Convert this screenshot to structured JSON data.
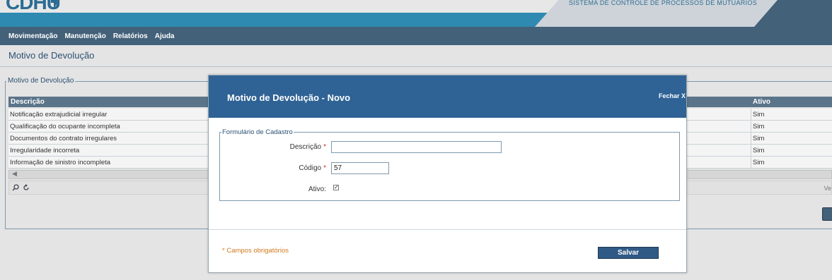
{
  "app": {
    "logo_text": "CDHU",
    "system_title": "SISTEMA DE CONTROLE DE PROCESSOS DE MUTUÁRIOS"
  },
  "menu": [
    "Movimentação",
    "Manutenção",
    "Relatórios",
    "Ajuda"
  ],
  "page": {
    "title": "Motivo de Devolução"
  },
  "grid": {
    "legend": "Motivo de Devolução",
    "columns": {
      "descricao": "Descrição",
      "ativo": "Ativo"
    },
    "rows": [
      {
        "descricao": "Notificação extrajudicial irregular",
        "ativo": "Sim"
      },
      {
        "descricao": "Qualificação do ocupante incompleta",
        "ativo": "Sim"
      },
      {
        "descricao": "Documentos do contrato irregulares",
        "ativo": "Sim"
      },
      {
        "descricao": "Irregularidade incorreta",
        "ativo": "Sim"
      },
      {
        "descricao": "Informação de sinistro incompleta",
        "ativo": "Sim"
      }
    ],
    "pager_right_text": "Ve",
    "icons": {
      "search": "search-icon",
      "refresh": "refresh-icon"
    }
  },
  "modal": {
    "title": "Motivo de Devolução - Novo",
    "close_label": "Fechar X",
    "form_legend": "Formulário de Cadastro",
    "fields": {
      "descricao": {
        "label": "Descrição",
        "required_mark": "*",
        "value": ""
      },
      "codigo": {
        "label": "Código",
        "required_mark": "*",
        "value": "57"
      },
      "ativo": {
        "label": "Ativo:",
        "checked": true
      }
    },
    "required_note": "* Campos obrigatórios",
    "save_label": "Salvar"
  },
  "colors": {
    "menubar": "#436179",
    "modal_header": "#2f6395",
    "required": "#c8302a",
    "note": "#d0781c"
  }
}
